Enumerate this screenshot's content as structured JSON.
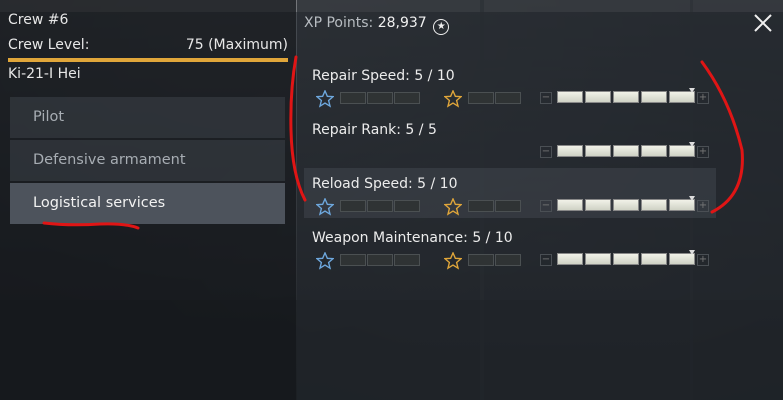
{
  "crew": {
    "title": "Crew #6",
    "level_label": "Crew Level:",
    "level_value": "75 (Maximum)",
    "level_progress": 1.0,
    "aircraft": "Ki-21-I Hei"
  },
  "nav": {
    "items": [
      {
        "label": "Pilot"
      },
      {
        "label": "Defensive armament"
      },
      {
        "label": "Logistical services"
      }
    ],
    "active_index": 2
  },
  "xp": {
    "label": "XP Points:",
    "value": "28,937"
  },
  "skills": [
    {
      "label": "Repair Speed: 5 / 10",
      "has_stars": true
    },
    {
      "label": "Repair Rank: 5 / 5",
      "has_stars": false
    },
    {
      "label": "Reload Speed: 5 / 10",
      "has_stars": true
    },
    {
      "label": "Weapon Maintenance: 5 / 10",
      "has_stars": true
    }
  ],
  "colors": {
    "accent": "#e0a63a",
    "annotation": "#e01515",
    "star_blue": "#6ea8de",
    "star_gold": "#e0a63a"
  },
  "icons": {
    "close": "close-icon",
    "xp": "star-circle-icon",
    "expert": "blue-star-icon",
    "ace": "gold-star-icon"
  }
}
